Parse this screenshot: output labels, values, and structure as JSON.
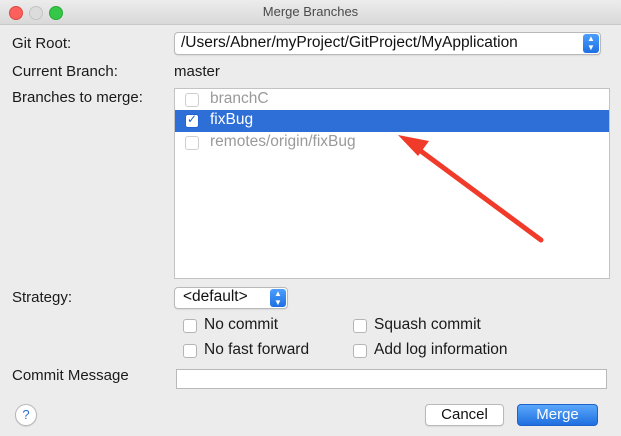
{
  "window": {
    "title": "Merge Branches"
  },
  "form": {
    "git_root_label": "Git Root:",
    "git_root_value": "/Users/Abner/myProject/GitProject/MyApplication",
    "current_branch_label": "Current Branch:",
    "current_branch_value": "master",
    "branches_label": "Branches to merge:",
    "branches": [
      {
        "label": "branchC",
        "checked": false,
        "selected": false
      },
      {
        "label": "fixBug",
        "checked": true,
        "selected": true
      },
      {
        "label": "remotes/origin/fixBug",
        "checked": false,
        "selected": false
      }
    ],
    "strategy_label": "Strategy:",
    "strategy_value": "<default>",
    "options": {
      "no_commit": "No commit",
      "squash_commit": "Squash commit",
      "no_fast_forward": "No fast forward",
      "add_log_information": "Add log information"
    },
    "commit_message_label": "Commit Message",
    "commit_message_value": ""
  },
  "buttons": {
    "help": "?",
    "cancel": "Cancel",
    "merge": "Merge"
  },
  "colors": {
    "accent": "#2e6ed7",
    "annotation_arrow": "#f03a2a"
  }
}
